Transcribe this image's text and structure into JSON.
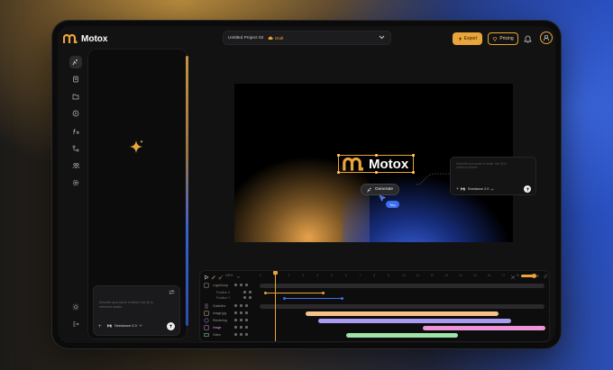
{
  "app": {
    "name": "Motox"
  },
  "header": {
    "project_title": "Untitled Project 03",
    "draft_label": "Draft",
    "export_label": "Export",
    "pricing_label": "Pricing"
  },
  "sidebar": {
    "items": [
      {
        "name": "generate"
      },
      {
        "name": "assets"
      },
      {
        "name": "folder"
      },
      {
        "name": "media"
      },
      {
        "name": "function"
      },
      {
        "name": "nodes"
      },
      {
        "name": "team"
      },
      {
        "name": "settings"
      }
    ],
    "bottom": [
      {
        "name": "theme"
      },
      {
        "name": "logout"
      }
    ]
  },
  "panel": {
    "composer_placeholder": "Describe your scene in detail. Use @ to reference assets",
    "model": "Seedance 2.0"
  },
  "canvas": {
    "logo_text": "Motox",
    "generate_label": "Generate",
    "cursor_label": "You",
    "mini_placeholder": "Describe your scene in detail. Use @ to reference assets",
    "mini_model": "Seedance 2.0"
  },
  "timeline": {
    "zoom_value": "100%",
    "ticks": [
      "0",
      "1",
      "2",
      "3",
      "4",
      "5",
      "6",
      "7",
      "8",
      "9",
      "10",
      "11",
      "12",
      "13",
      "14",
      "15",
      "16",
      "17",
      "18",
      "19",
      "20"
    ],
    "rows": [
      {
        "label": "LogoGroup"
      },
      {
        "label": "Position X"
      },
      {
        "label": "Position Y"
      },
      {
        "label": "Guideline"
      },
      {
        "label": "Image.jpg"
      },
      {
        "label": "Rendering"
      },
      {
        "label": "Image"
      },
      {
        "label": "Video"
      }
    ]
  },
  "colors": {
    "accent": "#e9a43a",
    "blue": "#3d6ef0",
    "peach": "#f6c28a",
    "lavender": "#a99cf0",
    "pink": "#ee93d8",
    "green": "#9be3a6"
  }
}
